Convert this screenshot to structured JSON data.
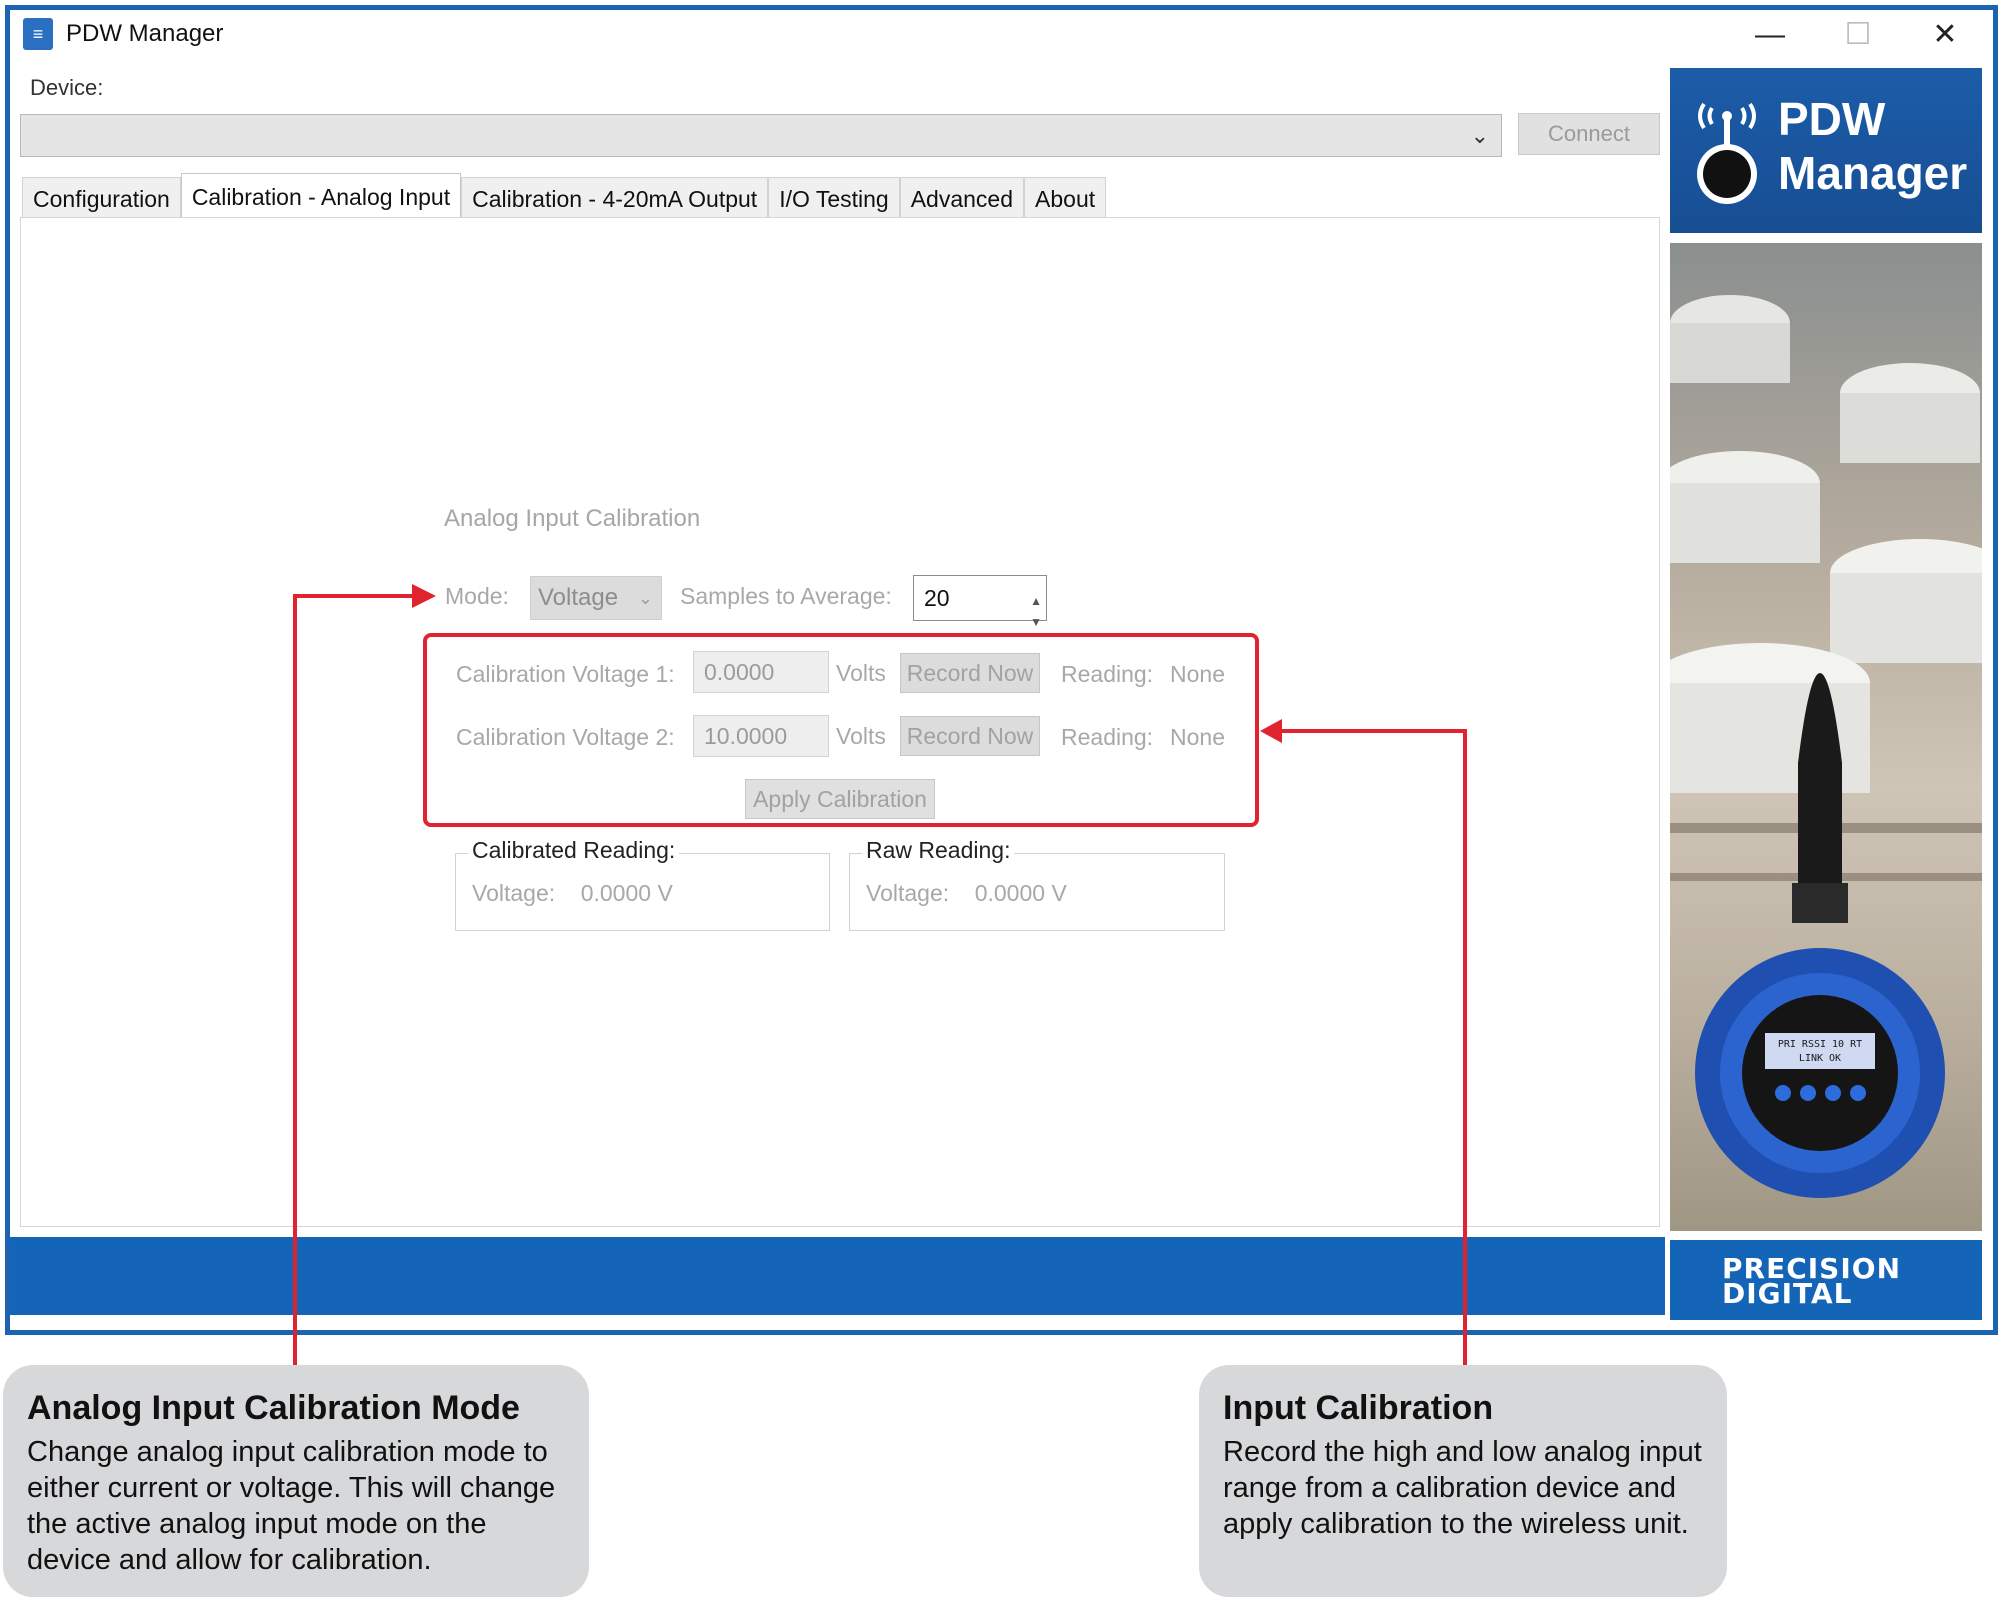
{
  "window": {
    "title": "PDW Manager",
    "minimize_glyph": "—",
    "maximize_glyph": "☐",
    "close_glyph": "✕"
  },
  "device": {
    "label": "Device:",
    "selected_value": "",
    "connect_label": "Connect"
  },
  "tabs": [
    {
      "label": "Configuration",
      "active": false
    },
    {
      "label": "Calibration - Analog Input",
      "active": true
    },
    {
      "label": "Calibration - 4-20mA Output",
      "active": false
    },
    {
      "label": "I/O Testing",
      "active": false
    },
    {
      "label": "Advanced",
      "active": false
    },
    {
      "label": "About",
      "active": false
    }
  ],
  "calibration": {
    "section_title": "Analog Input Calibration",
    "mode_label": "Mode:",
    "mode_value": "Voltage",
    "samples_label": "Samples to Average:",
    "samples_value": "20",
    "rows": [
      {
        "label": "Calibration Voltage 1:",
        "value": "0.0000",
        "unit": "Volts",
        "button": "Record Now",
        "reading_label": "Reading:",
        "reading_value": "None"
      },
      {
        "label": "Calibration Voltage 2:",
        "value": "10.0000",
        "unit": "Volts",
        "button": "Record Now",
        "reading_label": "Reading:",
        "reading_value": "None"
      }
    ],
    "apply_label": "Apply Calibration",
    "calibrated_reading": {
      "title": "Calibrated Reading:",
      "label": "Voltage:",
      "value": "0.0000 V"
    },
    "raw_reading": {
      "title": "Raw Reading:",
      "label": "Voltage:",
      "value": "0.0000 V"
    }
  },
  "brand": {
    "line1": "PDW",
    "line2": "Manager",
    "footer_line1": "PRECISION",
    "footer_line2": "DIGITAL",
    "display_line1": "PRI  RSSI 10  RT",
    "display_line2": "LINK OK"
  },
  "colors": {
    "highlight": "#e0232e",
    "brand_blue": "#1464b8",
    "window_border": "#1d63b1"
  },
  "callouts": [
    {
      "title": "Analog Input Calibration Mode",
      "body": "Change analog input calibration mode to either current or voltage. This will change the active analog input mode on the device and allow for calibration."
    },
    {
      "title": "Input Calibration",
      "body": "Record the high and low analog input range from a calibration device and apply calibration to the wireless unit."
    }
  ]
}
